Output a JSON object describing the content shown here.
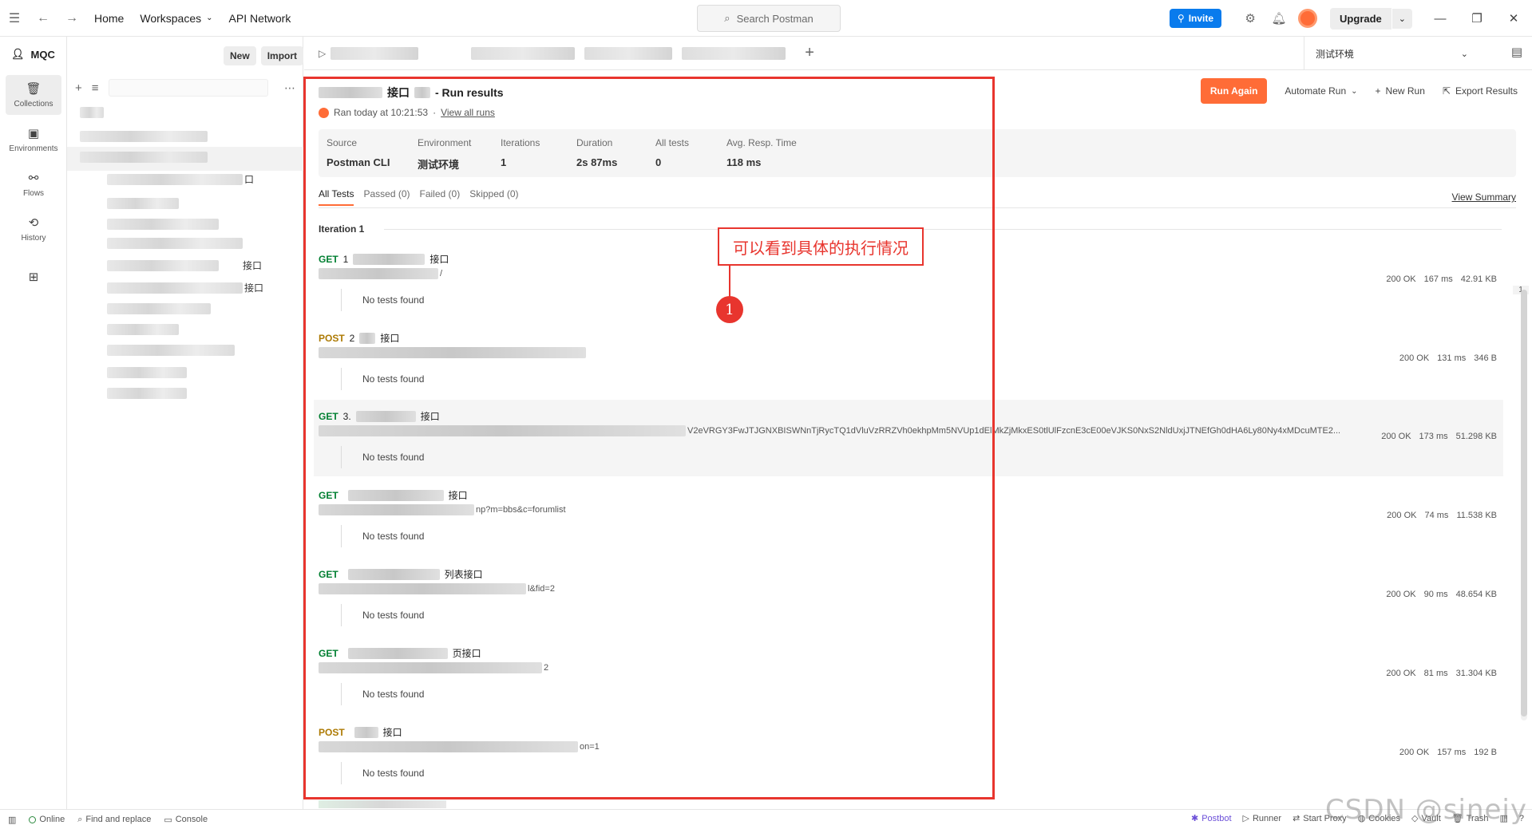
{
  "topbar": {
    "home": "Home",
    "workspaces": "Workspaces",
    "api_network": "API Network",
    "search_placeholder": "Search Postman",
    "invite": "Invite",
    "upgrade": "Upgrade"
  },
  "workspace": {
    "name": "MQC",
    "new": "New",
    "import": "Import"
  },
  "rail": {
    "collections": "Collections",
    "environments": "Environments",
    "flows": "Flows",
    "history": "History"
  },
  "sidebar_suffixes": [
    "口",
    "接口",
    "接口"
  ],
  "env_selector": "测试环境",
  "run": {
    "title_partial": "接口",
    "title_suffix": "- Run results",
    "ran_text": "Ran today at 10:21:53",
    "dot": "·",
    "view_all_runs": "View all runs",
    "run_again": "Run Again",
    "automate_run": "Automate Run",
    "new_run": "New Run",
    "export_results": "Export Results"
  },
  "stats": [
    {
      "label": "Source",
      "value": "Postman CLI"
    },
    {
      "label": "Environment",
      "value": "测试环境"
    },
    {
      "label": "Iterations",
      "value": "1"
    },
    {
      "label": "Duration",
      "value": "2s 87ms"
    },
    {
      "label": "All tests",
      "value": "0"
    },
    {
      "label": "Avg. Resp. Time",
      "value": "118 ms"
    }
  ],
  "filters": [
    "All Tests",
    "Passed (0)",
    "Failed (0)",
    "Skipped (0)"
  ],
  "view_summary": "View Summary",
  "iteration_label": "Iteration 1",
  "no_tests": "No tests found",
  "requests": [
    {
      "method": "GET",
      "name_prefix": "1",
      "name_suffix": "接口",
      "url_suffix": "/",
      "status": "200 OK",
      "time": "167 ms",
      "size": "42.91 KB"
    },
    {
      "method": "POST",
      "name_prefix": "2",
      "name_suffix": "接口",
      "url_suffix": "",
      "status": "200 OK",
      "time": "131 ms",
      "size": "346 B"
    },
    {
      "method": "GET",
      "name_prefix": "3.",
      "name_suffix": "接口",
      "url_suffix": "V2eVRGY3FwJTJGNXBISWNnTjRycTQ1dVluVzRRZVh0ekhpMm5NVUp1dElMkZjMkxES0tlUlFzcnE3cE00eVJKS0NxS2NldUxjJTNEfGh0dHA6Ly80Ny4xMDcuMTE2...",
      "status": "200 OK",
      "time": "173 ms",
      "size": "51.298 KB"
    },
    {
      "method": "GET",
      "name_prefix": "",
      "name_suffix": "接口",
      "url_suffix": "np?m=bbs&c=forumlist",
      "status": "200 OK",
      "time": "74 ms",
      "size": "11.538 KB"
    },
    {
      "method": "GET",
      "name_prefix": "",
      "name_suffix": "列表接口",
      "url_suffix": "l&fid=2",
      "status": "200 OK",
      "time": "90 ms",
      "size": "48.654 KB"
    },
    {
      "method": "GET",
      "name_prefix": "",
      "name_suffix": "页接口",
      "url_suffix": "2",
      "status": "200 OK",
      "time": "81 ms",
      "size": "31.304 KB"
    },
    {
      "method": "POST",
      "name_prefix": "",
      "name_suffix": "接口",
      "url_suffix": "on=1",
      "status": "200 OK",
      "time": "157 ms",
      "size": "192 B"
    }
  ],
  "annotation": {
    "text": "可以看到具体的执行情况",
    "number": "1"
  },
  "scroll_index": "1",
  "statusbar": {
    "online": "Online",
    "find_replace": "Find and replace",
    "console": "Console",
    "postbot": "Postbot",
    "runner": "Runner",
    "start_proxy": "Start Proxy",
    "cookies": "Cookies",
    "vault": "Vault",
    "trash": "Trash"
  },
  "watermark": "CSDN @sineiy",
  "colors": {
    "accent": "#ff6c37",
    "get": "#007f31",
    "post": "#ad7a03",
    "annotation": "#e8352e",
    "invite": "#097bed"
  }
}
